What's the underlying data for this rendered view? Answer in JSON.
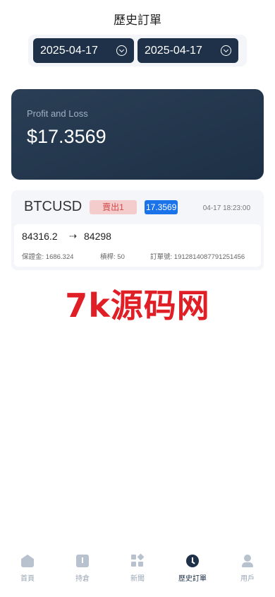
{
  "header": {
    "title": "歷史訂單"
  },
  "filters": {
    "start_date": "2025-04-17",
    "end_date": "2025-04-17"
  },
  "summary": {
    "label": "Profit and Loss",
    "value": "$17.3569"
  },
  "orders": [
    {
      "symbol": "BTCUSD",
      "side": "賣出1",
      "profit": "17.3569",
      "time": "04-17 18:23:00",
      "open_price": "84316.2",
      "close_price": "84298",
      "margin_label": "保證金:",
      "margin_value": "1686.324",
      "leverage_label": "槓桿:",
      "leverage_value": "50",
      "order_no_label": "訂單號:",
      "order_no_value": "1912814087791251456"
    }
  ],
  "watermark": "7k源码网",
  "tabs": [
    {
      "label": "首頁",
      "icon": "home-icon"
    },
    {
      "label": "持倉",
      "icon": "holdings-icon"
    },
    {
      "label": "新聞",
      "icon": "news-icon"
    },
    {
      "label": "歷史訂單",
      "icon": "clock-icon",
      "active": true
    },
    {
      "label": "用戶",
      "icon": "user-icon"
    }
  ],
  "colors": {
    "primary": "#1e3148",
    "sell": "#d04848",
    "profit_badge": "#1a73e8",
    "watermark": "#e01e26"
  }
}
